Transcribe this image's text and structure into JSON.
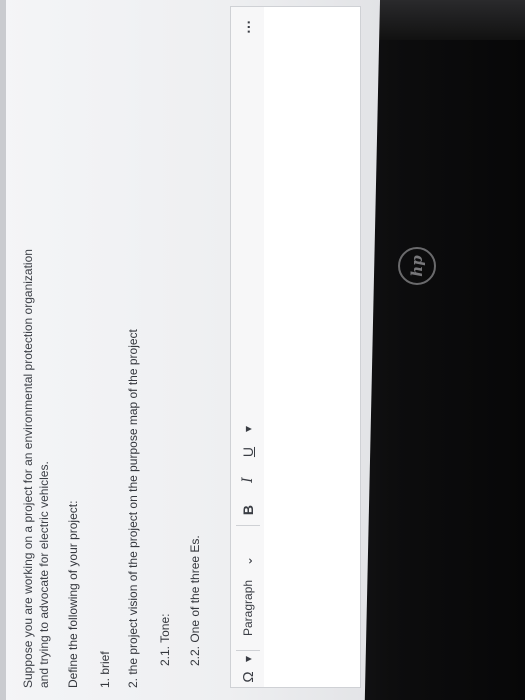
{
  "question": {
    "intro_line1": "Suppose you are working on a project for an environmental protection organization",
    "intro_line2": "and trying to advocate for electric vehicles.",
    "define_prompt": "Define the following of your project:",
    "item1": "1. brief",
    "item2": "2. the project vision of the project on the purpose map of the project",
    "item2_1": "2.1. Tone:",
    "item2_2": "2.2. One of the three Es."
  },
  "toolbar": {
    "special_char": "Ω",
    "dropdown_arrow": "▾",
    "paragraph_label": "Paragraph",
    "paragraph_chevron": "⌄",
    "bold_label": "B",
    "italic_label": "I",
    "underline_label": "U",
    "underline_arrow": "▾",
    "more_label": "⋯"
  },
  "device": {
    "logo": "hp"
  },
  "colors": {
    "screen_bg": "#eeeff1",
    "text": "#3a3d44",
    "bezel": "#0c0c0d"
  }
}
